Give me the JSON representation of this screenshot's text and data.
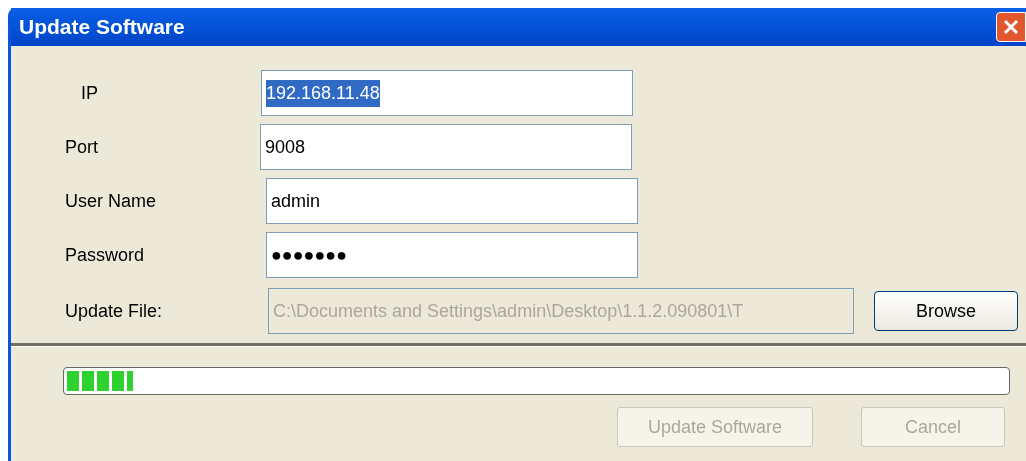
{
  "window": {
    "title": "Update Software"
  },
  "fields": [
    {
      "label": "IP",
      "value": "192.168.11.48",
      "highlighted": true,
      "disabled": false
    },
    {
      "label": "Port",
      "value": "9008",
      "highlighted": false,
      "disabled": false
    },
    {
      "label": "User Name",
      "value": "admin",
      "highlighted": false,
      "disabled": false
    },
    {
      "label": "Password",
      "value": "●●●●●●●",
      "highlighted": false,
      "disabled": false
    },
    {
      "label": "Update File:",
      "value": "C:\\Documents and Settings\\admin\\Desktop\\1.1.2.090801\\T",
      "highlighted": false,
      "disabled": true
    }
  ],
  "browse_button": {
    "label": "Browse",
    "disabled": false
  },
  "progress": {
    "level": 0.07
  },
  "buttons": [
    {
      "label": "Update Software",
      "disabled": true
    },
    {
      "label": "Cancel",
      "disabled": true
    }
  ]
}
